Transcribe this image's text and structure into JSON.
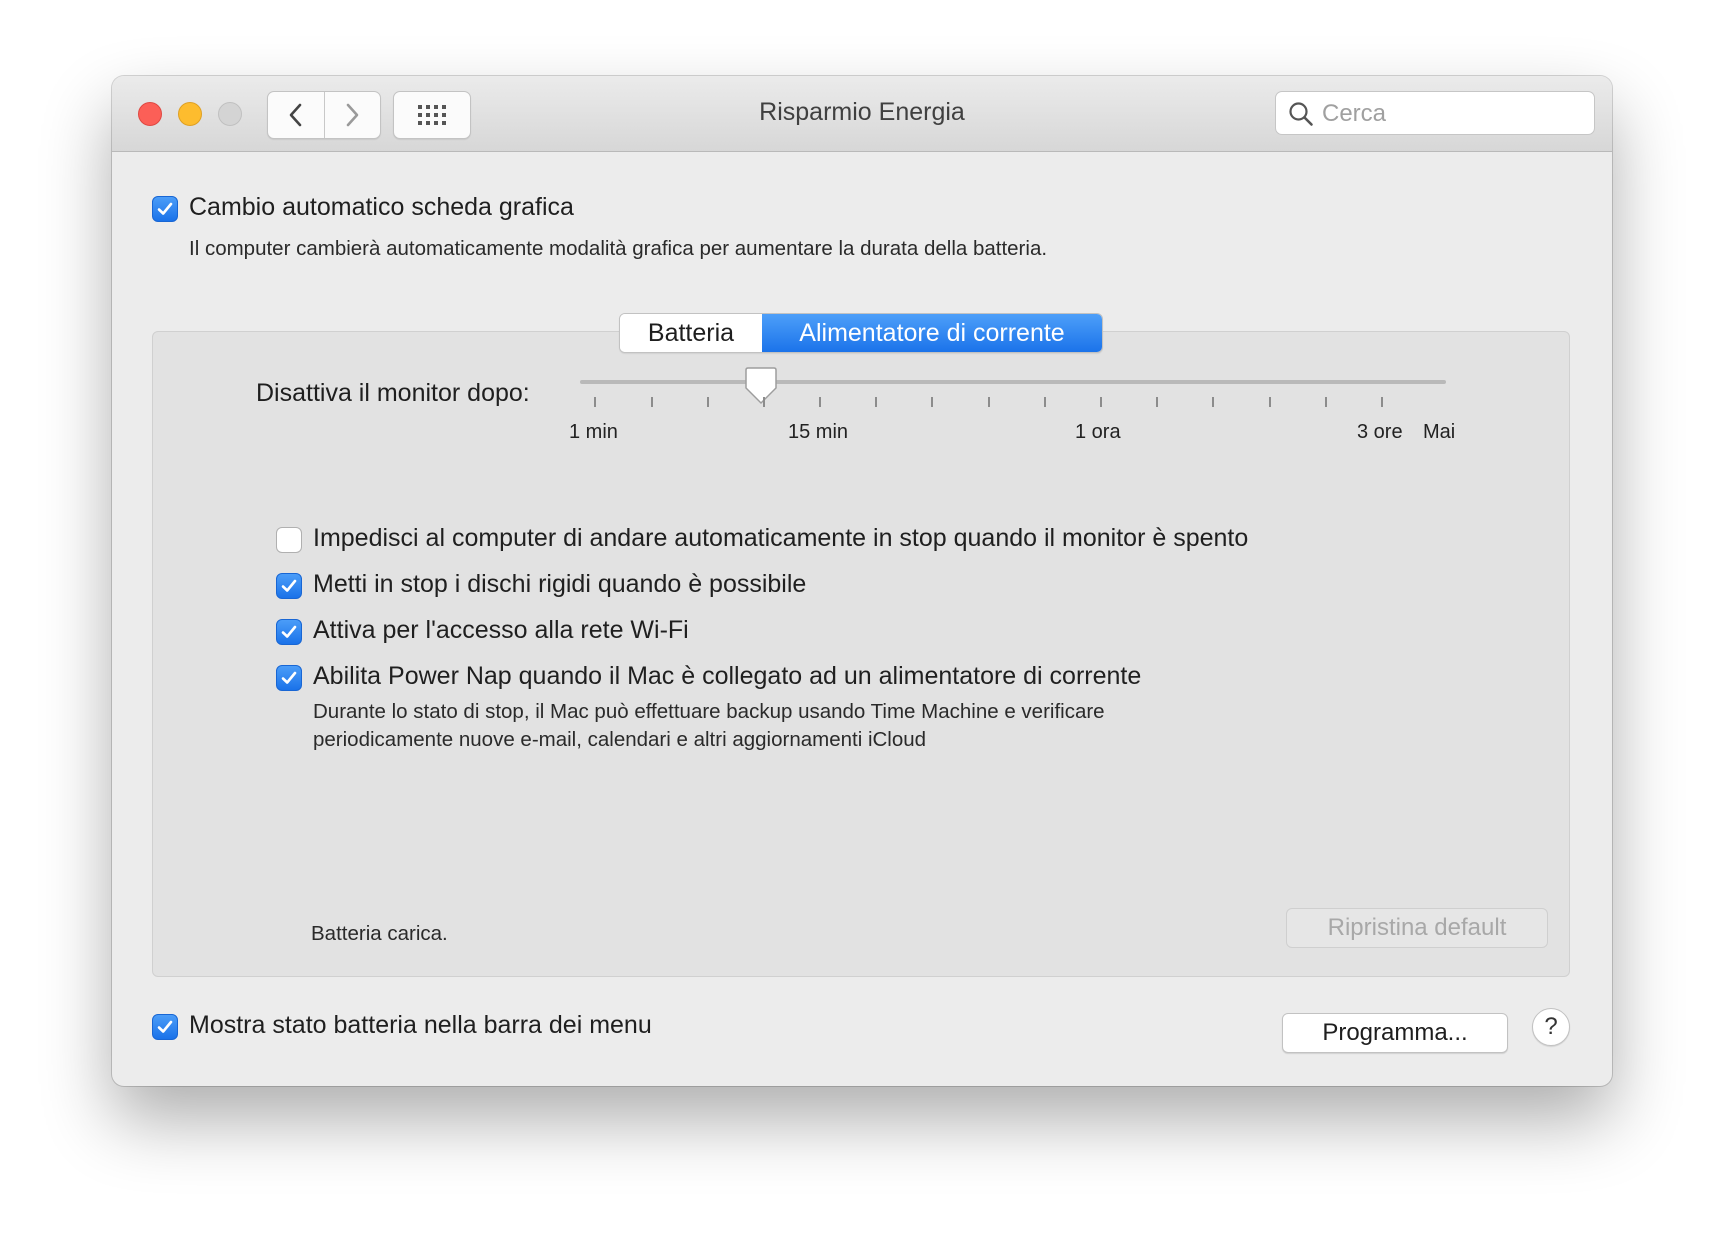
{
  "window": {
    "title": "Risparmio Energia"
  },
  "toolbar": {
    "search_placeholder": "Cerca"
  },
  "graphics_switching": {
    "checked": true,
    "label": "Cambio automatico scheda grafica",
    "description": "Il computer cambierà automaticamente modalità grafica per aumentare la durata della batteria."
  },
  "tabs": [
    {
      "label": "Batteria",
      "selected": false
    },
    {
      "label": "Alimentatore di corrente",
      "selected": true
    }
  ],
  "monitor_slider": {
    "label": "Disattiva il monitor dopo:",
    "value_label": "10 min",
    "tick_labels": [
      "1 min",
      "15 min",
      "1 ora",
      "3 ore",
      "Mai"
    ]
  },
  "options": [
    {
      "checked": false,
      "label": "Impedisci al computer di andare automaticamente in stop quando il monitor è spento"
    },
    {
      "checked": true,
      "label": "Metti in stop i dischi rigidi quando è possibile"
    },
    {
      "checked": true,
      "label": "Attiva per l'accesso alla rete Wi-Fi"
    },
    {
      "checked": true,
      "label": "Abilita Power Nap quando il Mac è collegato ad un alimentatore di corrente"
    }
  ],
  "power_nap_description": [
    "Durante lo stato di stop, il Mac può effettuare backup usando Time Machine e verificare",
    "periodicamente nuove e-mail, calendari e altri aggiornamenti iCloud"
  ],
  "battery_status": "Batteria carica.",
  "restore_defaults_label": "Ripristina default",
  "menu_bar_battery": {
    "checked": true,
    "label": "Mostra stato batteria nella barra dei menu"
  },
  "schedule_button_label": "Programma...",
  "help_label": "?",
  "colors": {
    "accent": "#1a72e9",
    "close": "#fc5f57",
    "minimize": "#fdbc2e"
  }
}
